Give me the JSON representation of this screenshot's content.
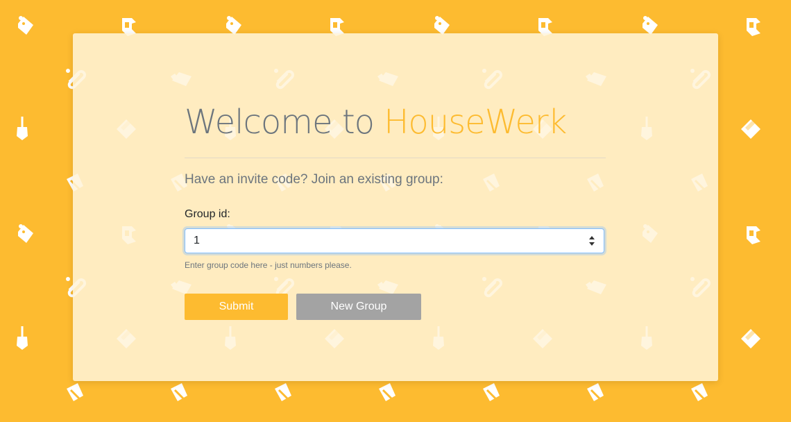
{
  "page": {
    "title_prefix": "Welcome to ",
    "brand_name": "HouseWerk",
    "lead": "Have an invite code? Join an existing group:"
  },
  "form": {
    "group_label": "Group id:",
    "group_value": "1",
    "help_text": "Enter group code here - just numbers please.",
    "submit_label": "Submit",
    "new_group_label": "New Group"
  },
  "theme": {
    "accent": "#fdbb30",
    "card": "#fff3d9",
    "secondary_button": "#a3a3a3",
    "muted_text": "#6c757d"
  },
  "background_icons": [
    "price-tag-icon",
    "spray-bottle-icon",
    "broom-icon",
    "sponge-icon",
    "dustpan-icon",
    "bucket-icon",
    "toilet-brush-icon"
  ]
}
